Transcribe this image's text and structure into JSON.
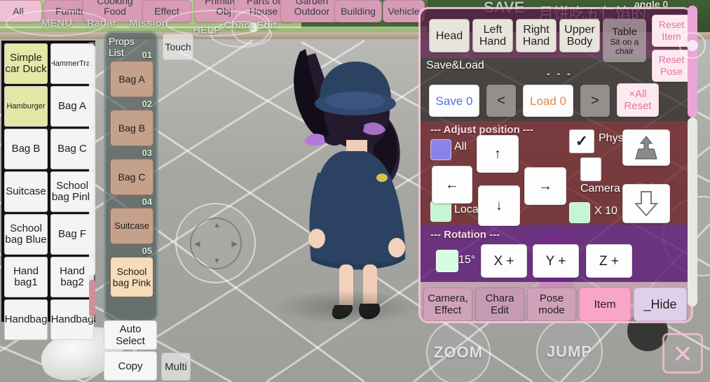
{
  "top_tabs": [
    {
      "label": "All",
      "selected": true
    },
    {
      "label": "Furniture",
      "selected": false
    },
    {
      "label": "Cooking Food",
      "selected": false
    },
    {
      "label": "Effect",
      "selected": false
    },
    {
      "label": "Primitive Obj",
      "selected": false
    },
    {
      "label": "Parts of House",
      "selected": false
    },
    {
      "label": "Garden Outdoor",
      "selected": false
    },
    {
      "label": "Building",
      "selected": false
    },
    {
      "label": "Vehicle",
      "selected": false
    }
  ],
  "hud_row2": [
    {
      "label": "MENU"
    },
    {
      "label": "Radar"
    },
    {
      "label": "Mission"
    },
    {
      "label": "HELP"
    },
    {
      "label": "Chara Edit"
    }
  ],
  "hud": {
    "save": "SAVE",
    "angle": "angle  0",
    "chinese_banner": "月饼吃五仁馅的",
    "touch": "Touch"
  },
  "item_grid": {
    "items": [
      {
        "label": "Simple car Duck",
        "highlight": true,
        "small": false
      },
      {
        "label": "HammerTrap",
        "highlight": false,
        "small": true
      },
      {
        "label": "Hamburger",
        "highlight": true,
        "small": true
      },
      {
        "label": "Bag A",
        "highlight": false,
        "small": false
      },
      {
        "label": "Bag B",
        "highlight": false,
        "small": false
      },
      {
        "label": "Bag C",
        "highlight": false,
        "small": false
      },
      {
        "label": "Suitcase",
        "highlight": false,
        "small": false
      },
      {
        "label": "School bag Pink",
        "highlight": false,
        "small": false
      },
      {
        "label": "School bag Blue",
        "highlight": false,
        "small": false
      },
      {
        "label": "Bag F",
        "highlight": false,
        "small": false
      },
      {
        "label": "Hand bag1",
        "highlight": false,
        "small": false
      },
      {
        "label": "Hand bag2",
        "highlight": false,
        "small": false
      },
      {
        "label": "Handbag",
        "highlight": false,
        "small": false
      },
      {
        "label": "Handbag",
        "highlight": false,
        "small": false
      }
    ]
  },
  "props_panel": {
    "title_line1": "Props",
    "title_line2": "List",
    "entries": [
      {
        "num": "01",
        "label": "Bag A",
        "selected": false
      },
      {
        "num": "02",
        "label": "Bag B",
        "selected": false
      },
      {
        "num": "03",
        "label": "Bag C",
        "selected": false
      },
      {
        "num": "04",
        "label": "Suitcase",
        "selected": false
      },
      {
        "num": "05",
        "label": "School bag Pink",
        "selected": true
      }
    ],
    "auto_select": "Auto Select",
    "copy": "Copy",
    "multi": "Multi"
  },
  "control_panel": {
    "body_parts": [
      {
        "label": "Head"
      },
      {
        "label": "Left Hand"
      },
      {
        "label": "Right Hand"
      },
      {
        "label": "Upper Body"
      }
    ],
    "table": {
      "label": "Table",
      "sub": "Sit on a chair"
    },
    "reset_item": "Reset Item",
    "reset_pose": "Reset Pose",
    "save_load_label": "Save&Load",
    "dashes": "- - -",
    "save": "Save 0",
    "prev": "<",
    "load": "Load 0",
    "next": ">",
    "all_reset": "×All Reset",
    "adjust_position_label": "--- Adjust position ---",
    "all_label": "All",
    "all_color": "#8b82e8",
    "local_label": "Local",
    "local_color": "#c5f5d2",
    "arrow_up": "↑",
    "arrow_down": "↓",
    "arrow_left": "←",
    "arrow_right": "→",
    "physics_label": "Physics",
    "physics_checked": true,
    "camera_collision_label": "Camera Collision",
    "camera_collision_checked": false,
    "x10_label": "X 10",
    "x10_color": "#c5f5d2",
    "raise_icon": "raise-object-icon",
    "lower_icon": "lower-object-icon",
    "rotation_label": "--- Rotation ---",
    "rotation_step": "15°",
    "rotation_step_color": "#d9fbe4",
    "rot_x": "X +",
    "rot_y": "Y +",
    "rot_z": "Z +",
    "modes": [
      {
        "label": "Camera, Effect",
        "style": "mauve"
      },
      {
        "label": "Chara Edit",
        "style": "mauve2"
      },
      {
        "label": "Pose mode",
        "style": "mauve"
      },
      {
        "label": "Item",
        "style": "item"
      },
      {
        "label": "_Hide",
        "style": "hide"
      }
    ]
  },
  "bottom_controls": {
    "zoom": "ZOOM",
    "jump": "JUMP",
    "close": "×"
  },
  "colors": {
    "tab_pink": "#d79bb6",
    "tab_pink_selected": "#eec0d4",
    "panel_border": "#ffcde1",
    "maroon_band": "#6c181c",
    "violet_band": "#60167c",
    "item_button": "#f9a6c6"
  }
}
